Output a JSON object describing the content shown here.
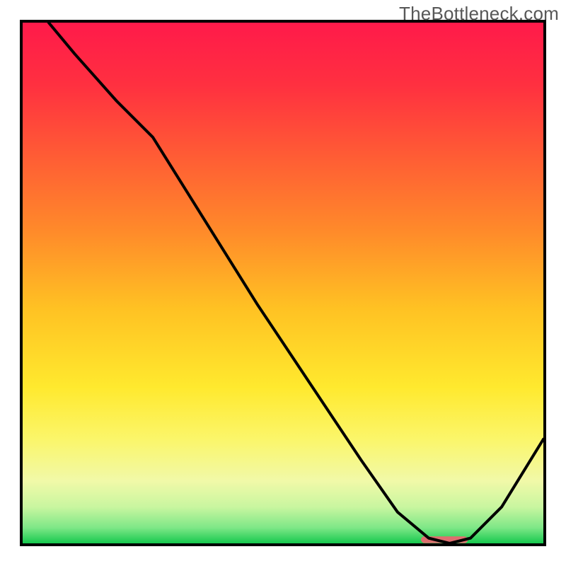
{
  "watermark": "TheBottleneck.com",
  "chart_data": {
    "type": "line",
    "title": "",
    "xlabel": "",
    "ylabel": "",
    "xlim": [
      0,
      100
    ],
    "ylim": [
      0,
      100
    ],
    "series": [
      {
        "name": "curve",
        "x": [
          5,
          10,
          18,
          25,
          35,
          45,
          55,
          65,
          72,
          78,
          82,
          86,
          92,
          100
        ],
        "values": [
          100,
          94,
          85,
          78,
          62,
          46,
          31,
          16,
          6,
          1,
          0,
          1,
          7,
          20
        ]
      }
    ],
    "marker": {
      "name": "optimal-zone",
      "x_center": 81,
      "y": 0.7,
      "width": 9,
      "height": 1.3,
      "color": "#dd6f6f"
    },
    "gradient_stops": [
      {
        "offset": 0.0,
        "color": "#ff1a4a"
      },
      {
        "offset": 0.12,
        "color": "#ff3040"
      },
      {
        "offset": 0.25,
        "color": "#ff5a35"
      },
      {
        "offset": 0.4,
        "color": "#ff8a2a"
      },
      {
        "offset": 0.55,
        "color": "#ffc223"
      },
      {
        "offset": 0.7,
        "color": "#ffe92e"
      },
      {
        "offset": 0.8,
        "color": "#fbf66a"
      },
      {
        "offset": 0.88,
        "color": "#f1f9a8"
      },
      {
        "offset": 0.93,
        "color": "#c9f6a0"
      },
      {
        "offset": 0.97,
        "color": "#7EE787"
      },
      {
        "offset": 1.0,
        "color": "#16c94e"
      }
    ]
  }
}
